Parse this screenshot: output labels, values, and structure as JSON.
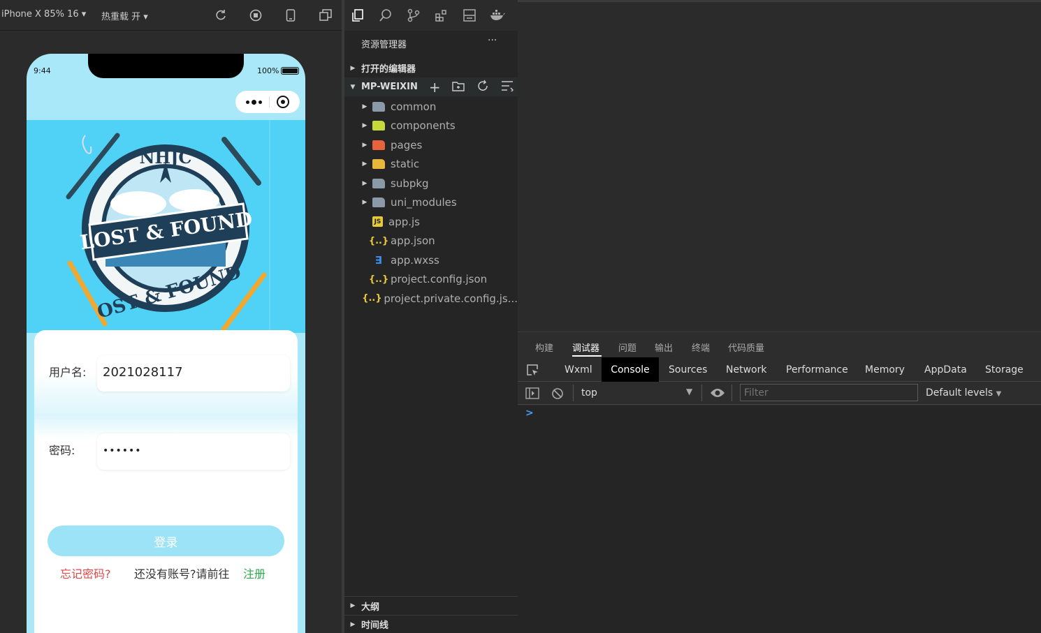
{
  "simulator": {
    "device": "iPhone X 85% 16",
    "hot_reload": "热重载 开"
  },
  "phone": {
    "time": "9:44",
    "battery": "100%",
    "username_label": "用户名:",
    "username_value": "2021028117",
    "password_label": "密码:",
    "password_value": "••••••",
    "login_button": "登录",
    "forgot_password": "忘记密码?",
    "no_account": "还没有账号?请前往",
    "register": "注册",
    "logo_top": "NHJC",
    "logo_banner": "LOST & FOUND",
    "logo_bottom": "OST & FOUND"
  },
  "explorer": {
    "title": "资源管理器",
    "more": "···",
    "open_editors": "打开的编辑器",
    "project": "MP-WEIXIN",
    "outline": "大纲",
    "timeline": "时间线",
    "items": [
      {
        "label": "common",
        "kind": "folder",
        "color": "#8a9aa8"
      },
      {
        "label": "components",
        "kind": "folder",
        "color": "#c5d93a"
      },
      {
        "label": "pages",
        "kind": "folder",
        "color": "#e8623c"
      },
      {
        "label": "static",
        "kind": "folder",
        "color": "#e8b83a"
      },
      {
        "label": "subpkg",
        "kind": "folder",
        "color": "#8a9aa8"
      },
      {
        "label": "uni_modules",
        "kind": "folder",
        "color": "#8a9aa8"
      },
      {
        "label": "app.js",
        "kind": "js",
        "color": "#e8c93a"
      },
      {
        "label": "app.json",
        "kind": "json",
        "color": "#e8c93a"
      },
      {
        "label": "app.wxss",
        "kind": "css",
        "color": "#3a8ee8"
      },
      {
        "label": "project.config.json",
        "kind": "json",
        "color": "#e8c93a"
      },
      {
        "label": "project.private.config.js...",
        "kind": "json",
        "color": "#e8c93a"
      }
    ]
  },
  "panel": {
    "tabs": [
      "构建",
      "调试器",
      "问题",
      "输出",
      "终端",
      "代码质量"
    ],
    "active_tab": "调试器"
  },
  "devtools": {
    "tabs": [
      "Wxml",
      "Console",
      "Sources",
      "Network",
      "Performance",
      "Memory",
      "AppData",
      "Storage"
    ],
    "active_tab": "Console",
    "context": "top",
    "filter_placeholder": "Filter",
    "levels": "Default levels",
    "prompt": ">"
  },
  "colors": {
    "accent_blue": "#4fd2f5",
    "login_button": "#9de3f7",
    "forgot_red": "#e04848",
    "register_green": "#2aa84a"
  }
}
